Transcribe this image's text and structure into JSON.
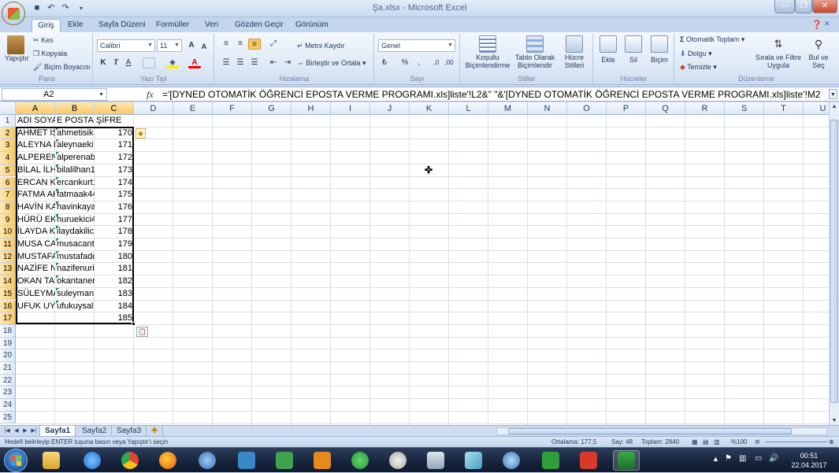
{
  "window": {
    "title": "Şa.xlsx - Microsoft Excel"
  },
  "ribbon_tabs": [
    "Giriş",
    "Ekle",
    "Sayfa Düzeni",
    "Formüller",
    "Veri",
    "Gözden Geçir",
    "Görünüm"
  ],
  "ribbon": {
    "clipboard": {
      "paste": "Yapıştır",
      "cut": "Kes",
      "copy": "Kopyala",
      "format_painter": "Biçim Boyacısı",
      "label": "Pano"
    },
    "font": {
      "name": "Calibri",
      "size": "11",
      "label": "Yazı Tipi"
    },
    "alignment": {
      "wrap": "Metni Kaydır",
      "merge": "Birleştir ve Ortala",
      "label": "Hizalama"
    },
    "number": {
      "format": "Genel",
      "label": "Sayı"
    },
    "styles": {
      "conditional": "Koşullu Biçimlendirme",
      "table": "Tablo Olarak Biçimlendir",
      "cell": "Hücre Stilleri",
      "label": "Stiller"
    },
    "cells": {
      "insert": "Ekle",
      "delete": "Sil",
      "format": "Biçim",
      "label": "Hücreler"
    },
    "editing": {
      "autosum": "Otomatik Toplam",
      "fill": "Dolgu",
      "clear": "Temizle",
      "sort": "Sırala ve Filtre Uygula",
      "find": "Bul ve Seç",
      "label": "Düzenleme"
    }
  },
  "formula_bar": {
    "name_box": "A2",
    "fx": "fx",
    "formula": "='[DYNED OTOMATİK ÖĞRENCİ EPOSTA VERME PROGRAMI.xls]liste'!L2&\" \"&'[DYNED OTOMATİK ÖĞRENCİ EPOSTA VERME PROGRAMI.xls]liste'!M2"
  },
  "columns": [
    "A",
    "B",
    "C",
    "D",
    "E",
    "F",
    "G",
    "H",
    "I",
    "J",
    "K",
    "L",
    "M",
    "N",
    "O",
    "P",
    "Q",
    "R",
    "S",
    "T",
    "U"
  ],
  "rows": [
    "1",
    "2",
    "3",
    "4",
    "5",
    "6",
    "7",
    "8",
    "9",
    "10",
    "11",
    "12",
    "13",
    "14",
    "15",
    "16",
    "17",
    "18",
    "19",
    "20",
    "21",
    "22",
    "23",
    "24",
    "25"
  ],
  "headers": {
    "a": "ADI SOYADI",
    "b": "E POSTA",
    "c": "ŞİFRE"
  },
  "data_rows": [
    {
      "a": "AHMET IŞIK",
      "b": "ahmetisik",
      "c": "170"
    },
    {
      "a": "ALEYNA ERDEM",
      "b": "aleynaeki",
      "c": "171"
    },
    {
      "a": "ALPEREN ABAR",
      "b": "alperenab",
      "c": "172"
    },
    {
      "a": "BİLAL İLHAN",
      "b": "bilalilhan1",
      "c": "173"
    },
    {
      "a": "ERCAN KURT",
      "b": "ercankurt1",
      "c": "174"
    },
    {
      "a": "FATMA AK",
      "b": "fatmaak44",
      "c": "175"
    },
    {
      "a": "HAVİN KAYA",
      "b": "havinkaya",
      "c": "176"
    },
    {
      "a": "HÜRÜ EKİCİ",
      "b": "huruekici4",
      "c": "177"
    },
    {
      "a": "İLAYDA KILIÇ",
      "b": "ilaydakilic",
      "c": "178"
    },
    {
      "a": "MUSA CANTÜRK",
      "b": "musacantu",
      "c": "179"
    },
    {
      "a": "MUSTAFA AD",
      "b": "mustafadc",
      "c": "180"
    },
    {
      "a": "NAZİFE NUR",
      "b": "nazifenuri",
      "c": "181"
    },
    {
      "a": "OKAN TANER",
      "b": "okantaner",
      "c": "182"
    },
    {
      "a": "SÜLEYMAN",
      "b": "suleyman",
      "c": "183"
    },
    {
      "a": "UFUK UYSAL",
      "b": "ufukuysal",
      "c": "184"
    },
    {
      "a": "",
      "b": "",
      "c": "185"
    }
  ],
  "sheet_tabs": [
    "Sayfa1",
    "Sayfa2",
    "Sayfa3"
  ],
  "status": {
    "message": "Hedefi belirleyip ENTER tuşuna basın veya Yapıştır'ı seçin",
    "average": "Ortalama: 177,5",
    "count": "Say: 48",
    "sum": "Toplam: 2840",
    "zoom": "%100"
  },
  "taskbar": {
    "time": "00:51",
    "date": "22.04.2017"
  }
}
